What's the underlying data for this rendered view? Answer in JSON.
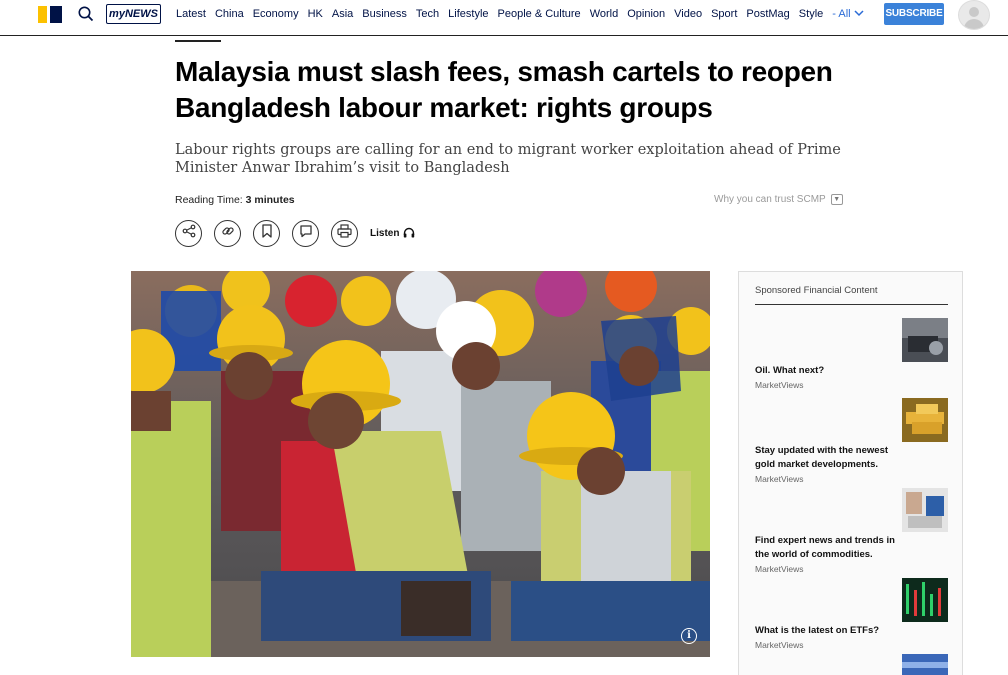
{
  "nav": {
    "mynews": "myNEWS",
    "links": [
      "Latest",
      "China",
      "Economy",
      "HK",
      "Asia",
      "Business",
      "Tech",
      "Lifestyle",
      "People & Culture",
      "World",
      "Opinion",
      "Video",
      "Sport",
      "PostMag",
      "Style"
    ],
    "all_label": "- All",
    "subscribe": "SUBSCRIBE"
  },
  "article": {
    "headline": "Malaysia must slash fees, smash cartels to reopen Bangladesh labour market: rights groups",
    "subheadline": "Labour rights groups are calling for an end to migrant worker exploitation ahead of Prime Minister Anwar Ibrahim’s visit to Bangladesh",
    "reading_time_label": "Reading Time:",
    "reading_time_value": "3 minutes",
    "trust_label": "Why you can trust SCMP",
    "listen_label": "Listen"
  },
  "sidebar": {
    "title": "Sponsored Financial Content",
    "items": [
      {
        "headline": "Oil. What next?",
        "source": "MarketViews"
      },
      {
        "headline": "Stay updated with the newest gold market developments.",
        "source": "MarketViews"
      },
      {
        "headline": "Find expert news and trends in the world of commodities.",
        "source": "MarketViews"
      },
      {
        "headline": "What is the latest on ETFs?",
        "source": "MarketViews"
      }
    ]
  },
  "colors": {
    "brand_navy": "#001246",
    "brand_yellow": "#fcc100",
    "subscribe_blue": "#3b82d9",
    "hard_hat_yellow": "#f2c21b",
    "vest_green": "#b9cf5a"
  }
}
